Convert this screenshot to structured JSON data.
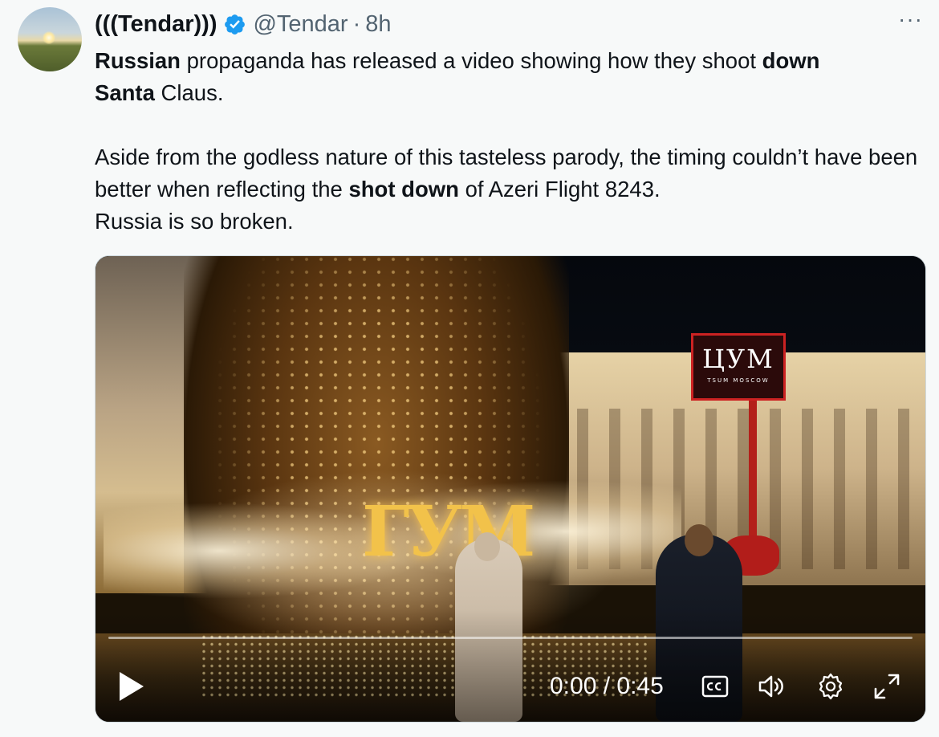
{
  "tweet": {
    "author": {
      "display_name": "(((Tendar)))",
      "handle": "@Tendar",
      "separator": "·",
      "time": "8h",
      "verified": true,
      "avatar_icon": "sunset-field-avatar"
    },
    "more_label": "···",
    "text_segments": [
      {
        "text": "Russian",
        "bold": true
      },
      {
        "text": " propaganda has released a video showing how they shoot ",
        "bold": false
      },
      {
        "text": "down",
        "bold": true
      },
      {
        "text": "\n",
        "bold": false
      },
      {
        "text": "Santa",
        "bold": true
      },
      {
        "text": " Claus.\n\nAside from the godless nature of this tasteless parody, the timing couldn’t have been better when reflecting the ",
        "bold": false
      },
      {
        "text": "shot down",
        "bold": true
      },
      {
        "text": " of Azeri Flight 8243.\nRussia is so broken.",
        "bold": false
      }
    ]
  },
  "video": {
    "signs": {
      "tsum": "ЦУМ",
      "tsum_sub": "TSUM MOSCOW",
      "gum": "ГУМ"
    },
    "progress": 0,
    "current_time": "0:00",
    "time_separator": " / ",
    "duration": "0:45",
    "controls": {
      "play_icon": "play-icon",
      "cc_icon": "closed-captions-icon",
      "volume_icon": "volume-icon",
      "settings_icon": "gear-icon",
      "fullscreen_icon": "fullscreen-icon"
    },
    "accent_color": "#1d9bf0"
  },
  "colors": {
    "background": "#f7f9f9",
    "text": "#0f1419",
    "secondary_text": "#536471",
    "verified_badge": "#1d9bf0"
  }
}
